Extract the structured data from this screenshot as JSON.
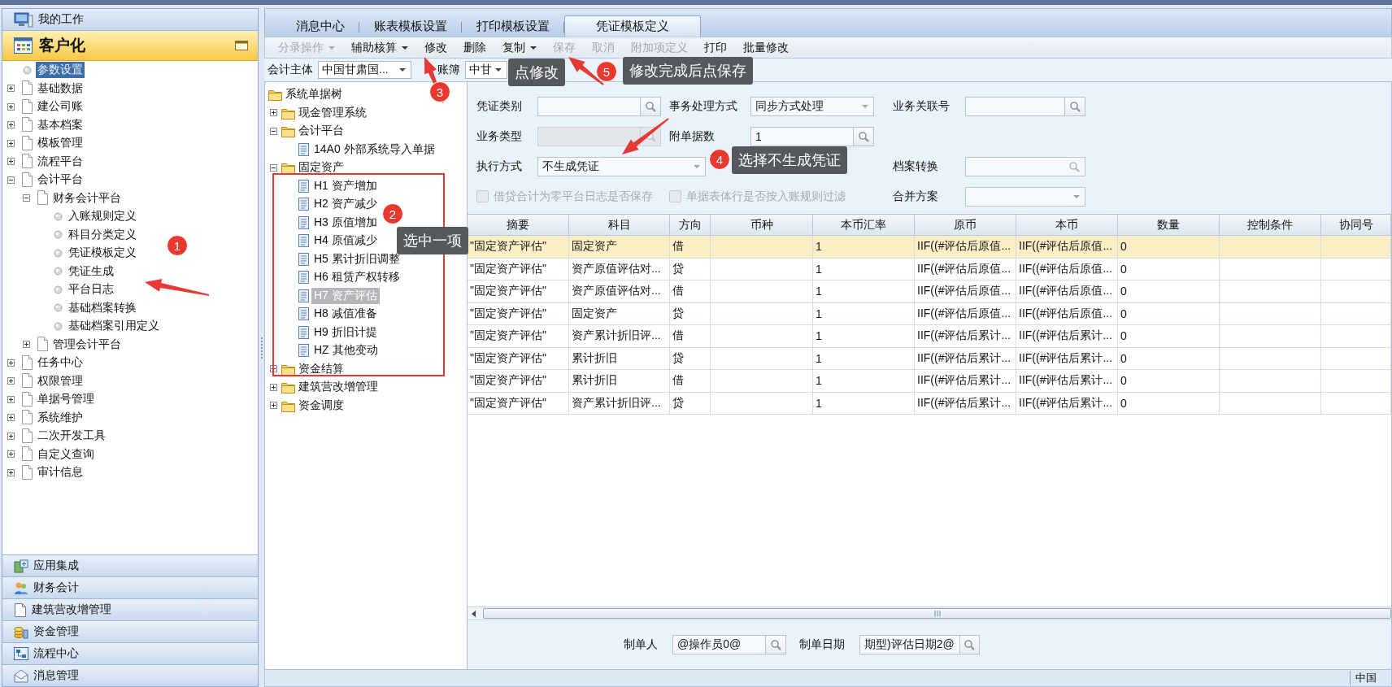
{
  "sidebar": {
    "header": "我的工作",
    "section": {
      "title": "客户化"
    },
    "tree": [
      {
        "label": "参数设置",
        "kind": "leaf",
        "selected": true
      },
      {
        "label": "基础数据",
        "kind": "node",
        "expanded": false,
        "selected": false
      },
      {
        "label": "建公司账",
        "kind": "node",
        "expanded": false,
        "selected": false
      },
      {
        "label": "基本档案",
        "kind": "node",
        "expanded": false,
        "selected": false
      },
      {
        "label": "模板管理",
        "kind": "node",
        "expanded": false,
        "selected": false
      },
      {
        "label": "流程平台",
        "kind": "node",
        "expanded": false,
        "selected": false
      },
      {
        "label": "会计平台",
        "kind": "node",
        "expanded": true,
        "selected": false,
        "children": [
          {
            "label": "财务会计平台",
            "kind": "node",
            "expanded": true,
            "selected": false,
            "children": [
              {
                "label": "入账规则定义",
                "kind": "leaf",
                "selected": false
              },
              {
                "label": "科目分类定义",
                "kind": "leaf",
                "selected": false
              },
              {
                "label": "凭证模板定义",
                "kind": "leaf",
                "selected": false
              },
              {
                "label": "凭证生成",
                "kind": "leaf",
                "selected": false
              },
              {
                "label": "平台日志",
                "kind": "leaf",
                "selected": false
              },
              {
                "label": "基础档案转换",
                "kind": "leaf",
                "selected": false
              },
              {
                "label": "基础档案引用定义",
                "kind": "leaf",
                "selected": false
              }
            ]
          },
          {
            "label": "管理会计平台",
            "kind": "node",
            "expanded": false,
            "selected": false
          }
        ]
      },
      {
        "label": "任务中心",
        "kind": "node",
        "expanded": false,
        "selected": false
      },
      {
        "label": "权限管理",
        "kind": "node",
        "expanded": false,
        "selected": false
      },
      {
        "label": "单据号管理",
        "kind": "node",
        "expanded": false,
        "selected": false
      },
      {
        "label": "系统维护",
        "kind": "node",
        "expanded": false,
        "selected": false
      },
      {
        "label": "二次开发工具",
        "kind": "node",
        "expanded": false,
        "selected": false
      },
      {
        "label": "自定义查询",
        "kind": "node",
        "expanded": false,
        "selected": false
      },
      {
        "label": "审计信息",
        "kind": "node",
        "expanded": false,
        "selected": false
      }
    ],
    "accordion": [
      {
        "label": "应用集成",
        "kind": "integration"
      },
      {
        "label": "财务会计",
        "kind": "people"
      },
      {
        "label": "建筑营改增管理",
        "kind": "document"
      },
      {
        "label": "资金管理",
        "kind": "coins"
      },
      {
        "label": "流程中心",
        "kind": "flow"
      },
      {
        "label": "消息管理",
        "kind": "mail"
      }
    ]
  },
  "tabs": [
    {
      "label": "消息中心",
      "selected": false
    },
    {
      "label": "账表模板设置",
      "selected": false
    },
    {
      "label": "打印模板设置",
      "selected": false
    },
    {
      "label": "凭证模板定义",
      "selected": true
    }
  ],
  "toolbar": [
    {
      "label": "分录操作",
      "disabled": true,
      "dropdown": true
    },
    {
      "label": "辅助核算",
      "disabled": false,
      "dropdown": true
    },
    {
      "label": "修改",
      "disabled": false,
      "dropdown": false
    },
    {
      "label": "删除",
      "disabled": false,
      "dropdown": false
    },
    {
      "label": "复制",
      "disabled": false,
      "dropdown": true
    },
    {
      "label": "保存",
      "disabled": true,
      "dropdown": false
    },
    {
      "label": "取消",
      "disabled": true,
      "dropdown": false
    },
    {
      "label": "附加项定义",
      "disabled": true,
      "dropdown": false
    },
    {
      "label": "打印",
      "disabled": false,
      "dropdown": false
    },
    {
      "label": "批量修改",
      "disabled": false,
      "dropdown": false
    }
  ],
  "filter": {
    "entity_label": "会计主体",
    "entity_value": "中国甘肃国...",
    "book_label": "账簿",
    "book_value": "中甘"
  },
  "bill_tree": [
    {
      "label": "系统单据树",
      "kind": "root",
      "selected": false,
      "children": [
        {
          "label": "现金管理系统",
          "kind": "folder",
          "expanded": false,
          "selected": false
        },
        {
          "label": "会计平台",
          "kind": "folder",
          "expanded": true,
          "selected": false,
          "children": [
            {
              "label": "14A0 外部系统导入单据",
              "kind": "bill",
              "selected": false
            }
          ]
        },
        {
          "label": "固定资产",
          "kind": "folder",
          "expanded": true,
          "selected": false,
          "children": [
            {
              "label": "H1 资产增加",
              "kind": "bill",
              "selected": false
            },
            {
              "label": "H2 资产减少",
              "kind": "bill",
              "selected": false
            },
            {
              "label": "H3 原值增加",
              "kind": "bill",
              "selected": false
            },
            {
              "label": "H4 原值减少",
              "kind": "bill",
              "selected": false
            },
            {
              "label": "H5 累计折旧调整",
              "kind": "bill",
              "selected": false
            },
            {
              "label": "H6 租赁产权转移",
              "kind": "bill",
              "selected": false
            },
            {
              "label": "H7 资产评估",
              "kind": "bill",
              "selected": true
            },
            {
              "label": "H8 减值准备",
              "kind": "bill",
              "selected": false
            },
            {
              "label": "H9 折旧计提",
              "kind": "bill",
              "selected": false
            },
            {
              "label": "HZ 其他变动",
              "kind": "bill",
              "selected": false
            }
          ]
        },
        {
          "label": "资金结算",
          "kind": "folder",
          "expanded": false,
          "selected": false
        },
        {
          "label": "建筑营改增管理",
          "kind": "folder",
          "expanded": false,
          "selected": false
        },
        {
          "label": "资金调度",
          "kind": "folder",
          "expanded": false,
          "selected": false
        }
      ]
    }
  ],
  "form": {
    "rows": [
      [
        {
          "kind": "lookup",
          "label": "凭证类别",
          "disabled": false
        },
        {
          "kind": "combo",
          "label": "事务处理方式",
          "value": "同步方式处理",
          "disabled": false
        },
        {
          "kind": "lookup",
          "label": "业务关联号",
          "disabled": false
        }
      ],
      [
        {
          "kind": "lookup",
          "label": "业务类型",
          "disabled": true
        },
        {
          "kind": "lookup",
          "label": "附单据数",
          "value": "1",
          "disabled": false
        }
      ],
      [
        {
          "kind": "wide-combo",
          "label": "执行方式",
          "value": "不生成凭证",
          "disabled": false
        },
        "",
        {
          "kind": "search",
          "label": "档案转换",
          "disabled": false
        }
      ],
      [
        {
          "kind": "checkbox",
          "label": "借贷合计为零平台日志是否保存",
          "checked": false,
          "disabled": true
        },
        {
          "kind": "checkbox",
          "label": "单据表体行是否按入账规则过滤",
          "checked": false,
          "disabled": true
        },
        {
          "kind": "combo",
          "label": "合并方案",
          "disabled": false
        }
      ]
    ]
  },
  "table": {
    "columns": [
      "摘要",
      "科目",
      "方向",
      "币种",
      "本币汇率",
      "原币",
      "本币",
      "数量",
      "控制条件",
      "协同号"
    ],
    "rows": [
      {
        "selected": true,
        "cells": [
          "\"固定资产评估\"",
          "固定资产",
          "借",
          "",
          "1",
          "IIF((#评估后原值...",
          "IIF((#评估后原值...",
          "0",
          "",
          ""
        ]
      },
      {
        "selected": false,
        "cells": [
          "\"固定资产评估\"",
          "资产原值评估对...",
          "贷",
          "",
          "1",
          "IIF((#评估后原值...",
          "IIF((#评估后原值...",
          "0",
          "",
          ""
        ]
      },
      {
        "selected": false,
        "cells": [
          "\"固定资产评估\"",
          "资产原值评估对...",
          "借",
          "",
          "1",
          "IIF((#评估后原值...",
          "IIF((#评估后原值...",
          "0",
          "",
          ""
        ]
      },
      {
        "selected": false,
        "cells": [
          "\"固定资产评估\"",
          "固定资产",
          "贷",
          "",
          "1",
          "IIF((#评估后原值...",
          "IIF((#评估后原值...",
          "0",
          "",
          ""
        ]
      },
      {
        "selected": false,
        "cells": [
          "\"固定资产评估\"",
          "资产累计折旧评...",
          "借",
          "",
          "1",
          "IIF((#评估后累计...",
          "IIF((#评估后累计...",
          "0",
          "",
          ""
        ]
      },
      {
        "selected": false,
        "cells": [
          "\"固定资产评估\"",
          "累计折旧",
          "贷",
          "",
          "1",
          "IIF((#评估后累计...",
          "IIF((#评估后累计...",
          "0",
          "",
          ""
        ]
      },
      {
        "selected": false,
        "cells": [
          "\"固定资产评估\"",
          "累计折旧",
          "借",
          "",
          "1",
          "IIF((#评估后累计...",
          "IIF((#评估后累计...",
          "0",
          "",
          ""
        ]
      },
      {
        "selected": false,
        "cells": [
          "\"固定资产评估\"",
          "资产累计折旧评...",
          "贷",
          "",
          "1",
          "IIF((#评估后累计...",
          "IIF((#评估后累计...",
          "0",
          "",
          ""
        ]
      }
    ]
  },
  "footer": {
    "maker_label": "制单人",
    "maker_value": "@操作员0@",
    "date_label": "制单日期",
    "date_value": "期型)评估日期2@"
  },
  "status_bar": "中国",
  "annotations": [
    {
      "number": "3",
      "note": "点修改"
    },
    {
      "number": "5",
      "note": "修改完成后点保存"
    },
    {
      "number": "4",
      "note": "选择不生成凭证"
    },
    {
      "number": "1"
    },
    {
      "number": "2",
      "note": "选中一项"
    }
  ]
}
